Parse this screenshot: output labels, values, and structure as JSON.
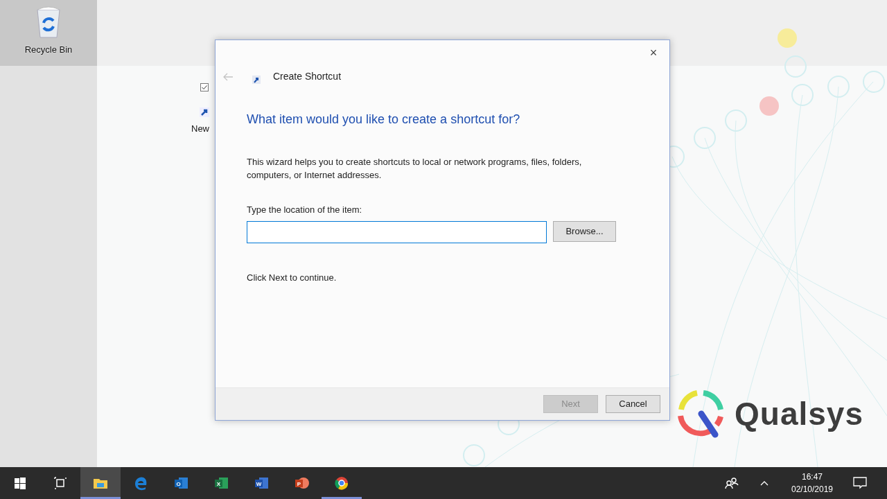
{
  "desktop_icons": [
    {
      "kind": "recycle-bin",
      "label": "Recycle Bin",
      "selected": true,
      "checked": false
    },
    {
      "kind": "shortcut",
      "label": "New",
      "selected": false,
      "checked": true
    }
  ],
  "dialog": {
    "title": "Create Shortcut",
    "back_disabled": true,
    "close": "×",
    "heading": "What item would you like to create a shortcut for?",
    "description": "This wizard helps you to create shortcuts to local or network programs, files, folders, computers, or Internet addresses.",
    "field": {
      "label": "Type the location of the item:",
      "focused": true
    },
    "browse": {
      "label": "Browse...",
      "disabled": false
    },
    "hint": "Click Next to continue.",
    "buttons": [
      {
        "label": "Next",
        "disabled": true
      },
      {
        "label": "Cancel",
        "disabled": false
      }
    ]
  },
  "logo": {
    "text": "Qualsys"
  },
  "taskbar": {
    "apps": [
      {
        "kind": "start",
        "active": false,
        "running": false
      },
      {
        "kind": "task-view",
        "active": false,
        "running": false
      },
      {
        "kind": "explorer",
        "active": true,
        "running": true
      },
      {
        "kind": "edge",
        "active": false,
        "running": false
      },
      {
        "kind": "mail",
        "glyph": "O",
        "active": false,
        "running": false
      },
      {
        "kind": "sheet",
        "glyph": "X",
        "active": false,
        "running": false
      },
      {
        "kind": "doc",
        "glyph": "W",
        "active": false,
        "running": false
      },
      {
        "kind": "slides",
        "glyph": "P",
        "active": false,
        "running": false
      },
      {
        "kind": "browser",
        "active": false,
        "running": true
      }
    ],
    "time": "16:47",
    "date": "02/10/2019"
  }
}
